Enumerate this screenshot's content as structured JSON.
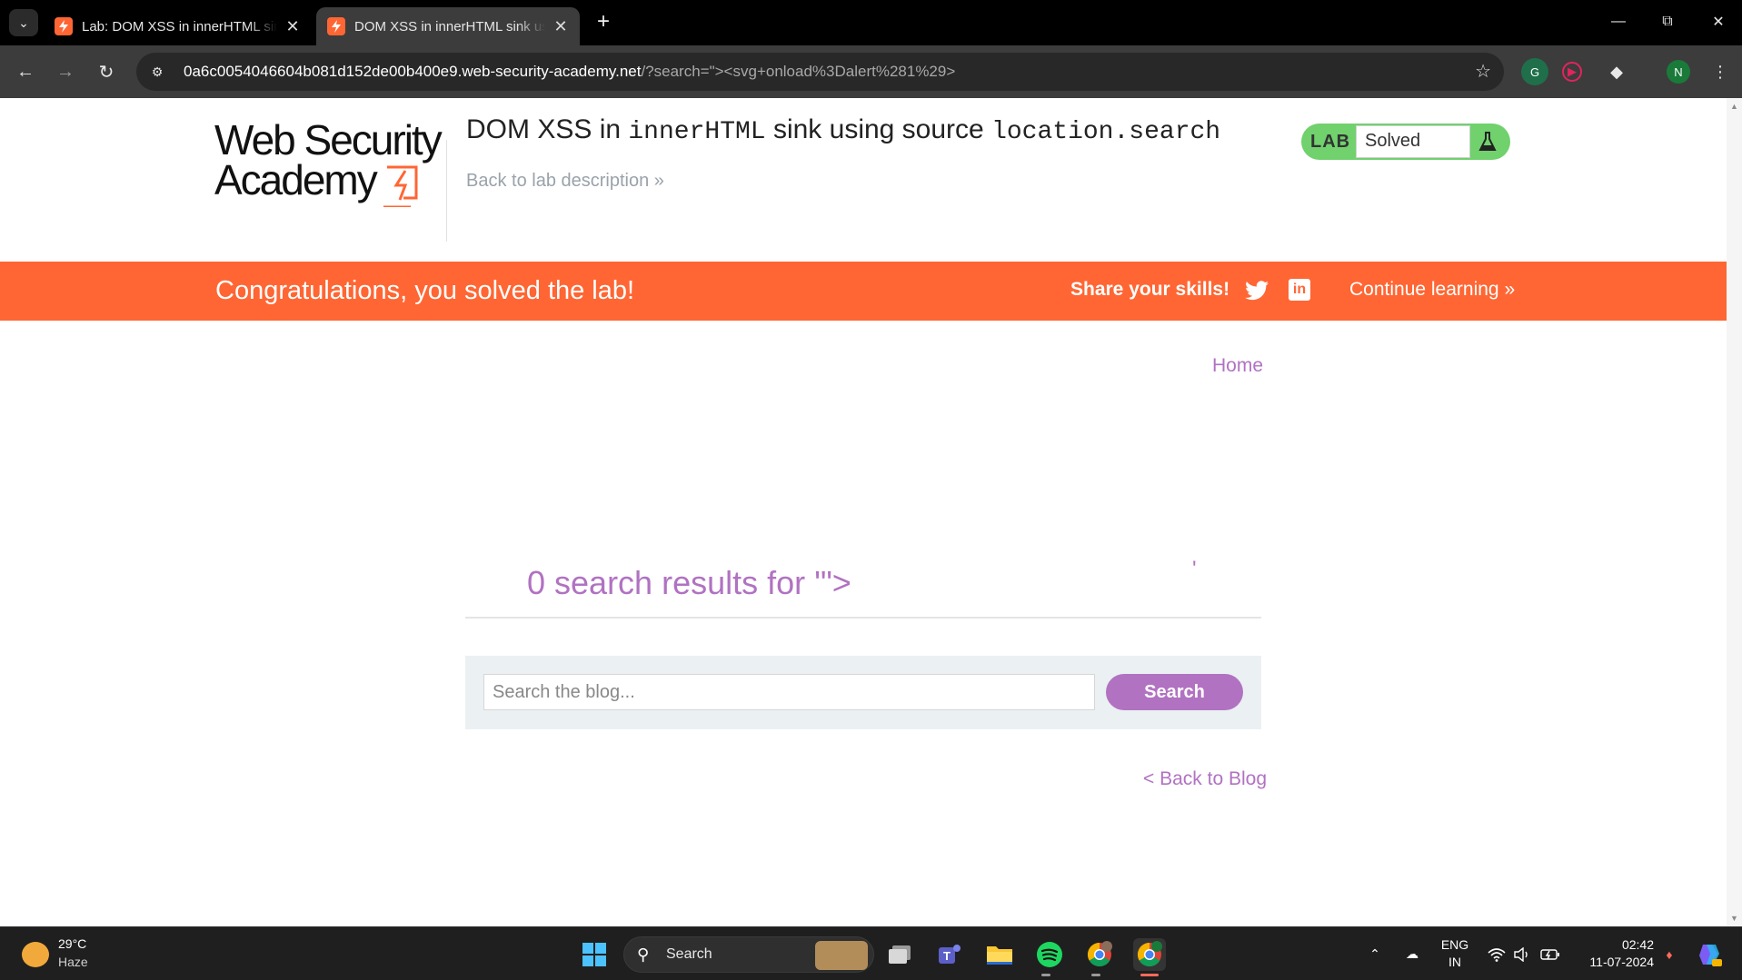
{
  "browser": {
    "tabs": [
      {
        "title": "Lab: DOM XSS in innerHTML sink using source location.search",
        "active": false
      },
      {
        "title": "DOM XSS in innerHTML sink using source location.search",
        "active": true
      }
    ],
    "url": {
      "host": "0a6c0054046604b081d152de00b400e9.web-security-academy.net",
      "query": "/?search=\"><svg+onload%3Dalert%281%29>"
    },
    "profile_initial": "N"
  },
  "header": {
    "logo_line1": "Web Security",
    "logo_line2": "Academy",
    "title_prefix": "DOM XSS in ",
    "title_code1": "innerHTML",
    "title_middle": " sink using source ",
    "title_code2": "location.search",
    "back_link": "Back to lab description",
    "lab_badge_label": "LAB",
    "lab_status": "Solved"
  },
  "banner": {
    "message": "Congratulations, you solved the lab!",
    "share_label": "Share your skills!",
    "continue_label": "Continue learning"
  },
  "nav": {
    "home": "Home"
  },
  "main": {
    "results_heading": "0 search results for '\">",
    "search_placeholder": "Search the blog...",
    "search_button": "Search",
    "back_to_blog": "< Back to Blog"
  },
  "taskbar": {
    "weather_temp": "29°C",
    "weather_cond": "Haze",
    "search_label": "Search",
    "lang_line1": "ENG",
    "lang_line2": "IN",
    "time": "02:42",
    "date": "11-07-2024"
  },
  "colors": {
    "brand_orange": "#ff6633",
    "link_purple": "#b172c2",
    "solved_green": "#70d16d"
  }
}
